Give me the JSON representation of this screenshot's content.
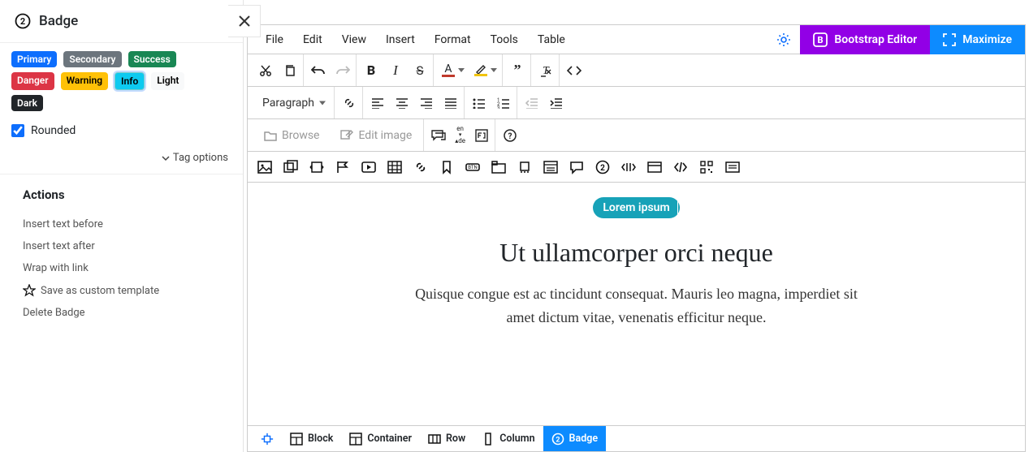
{
  "sidebar": {
    "title": "Badge",
    "badges": {
      "primary": "Primary",
      "secondary": "Secondary",
      "success": "Success",
      "danger": "Danger",
      "warning": "Warning",
      "info": "Info",
      "light": "Light",
      "dark": "Dark"
    },
    "rounded_label": "Rounded",
    "rounded_checked": true,
    "tag_options": "Tag options"
  },
  "actions": {
    "heading": "Actions",
    "insert_before": "Insert text before",
    "insert_after": "Insert text after",
    "wrap_link": "Wrap with link",
    "save_template": "Save as custom template",
    "delete": "Delete Badge"
  },
  "menu": {
    "file": "File",
    "edit": "Edit",
    "view": "View",
    "insert": "Insert",
    "format": "Format",
    "tools": "Tools",
    "table": "Table"
  },
  "header_buttons": {
    "bootstrap": "Bootstrap Editor",
    "maximize": "Maximize"
  },
  "toolbar": {
    "paragraph": "Paragraph",
    "browse": "Browse",
    "edit_image": "Edit image",
    "lang_top": "en",
    "lang_bottom": "de",
    "text_color": "#c0392b",
    "highlight_color": "#f1c40f"
  },
  "canvas": {
    "badge_text": "Lorem ipsum",
    "heading": "Ut ullamcorper orci neque",
    "paragraph": "Quisque congue est ac tincidunt consequat. Mauris leo magna, imperdiet sit amet dictum vitae, venenatis efficitur neque."
  },
  "breadcrumb": {
    "block": "Block",
    "container": "Container",
    "row": "Row",
    "column": "Column",
    "badge": "Badge"
  }
}
